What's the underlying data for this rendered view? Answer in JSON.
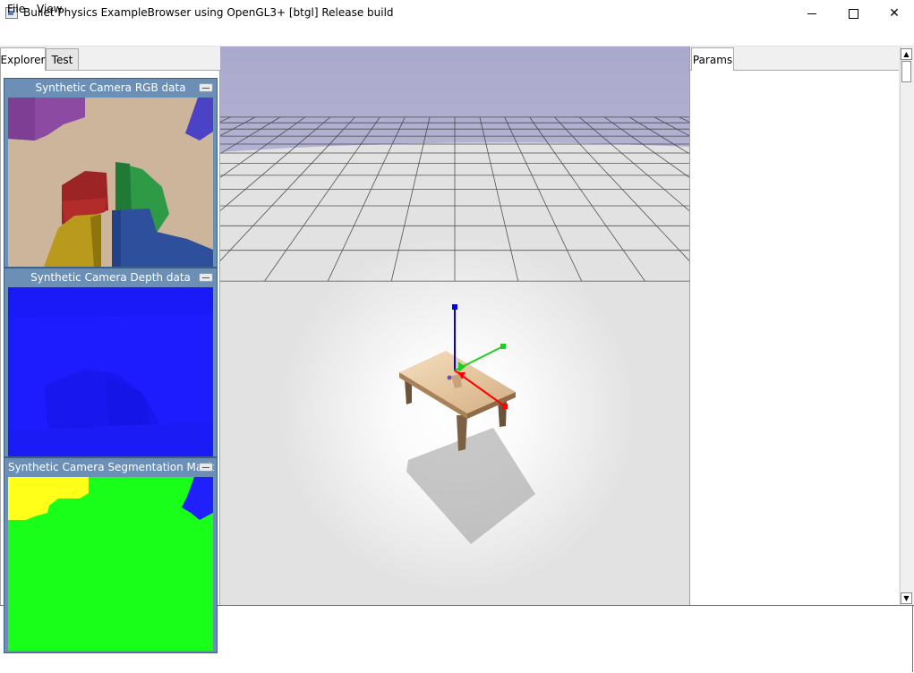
{
  "window": {
    "title": "Bullet Physics ExampleBrowser using OpenGL3+ [btgl] Release build",
    "minimize_glyph": "",
    "close_glyph": "✕"
  },
  "menu": {
    "file": "File",
    "view": "View"
  },
  "left_tabs": {
    "explorer": "Explorer",
    "test": "Test"
  },
  "right_tabs": {
    "params": "Params"
  },
  "scrollbar": {
    "up": "▲",
    "down": "▼"
  },
  "camera_windows": {
    "rgb": {
      "title": "Synthetic Camera RGB data"
    },
    "depth": {
      "title": "Synthetic Camera Depth data"
    },
    "segmentation": {
      "title": "Synthetic Camera Segmentation Mask"
    }
  },
  "colors": {
    "sky": "#aeaccf",
    "floor": "#e4e4e4",
    "depth_blue": "#1a1aff",
    "seg_green": "#1aff1a",
    "seg_yellow": "#ffff1a",
    "seg_blue": "#2020ff",
    "axis_x": "#ff0000",
    "axis_y": "#22cc22",
    "axis_z": "#0000dd"
  }
}
